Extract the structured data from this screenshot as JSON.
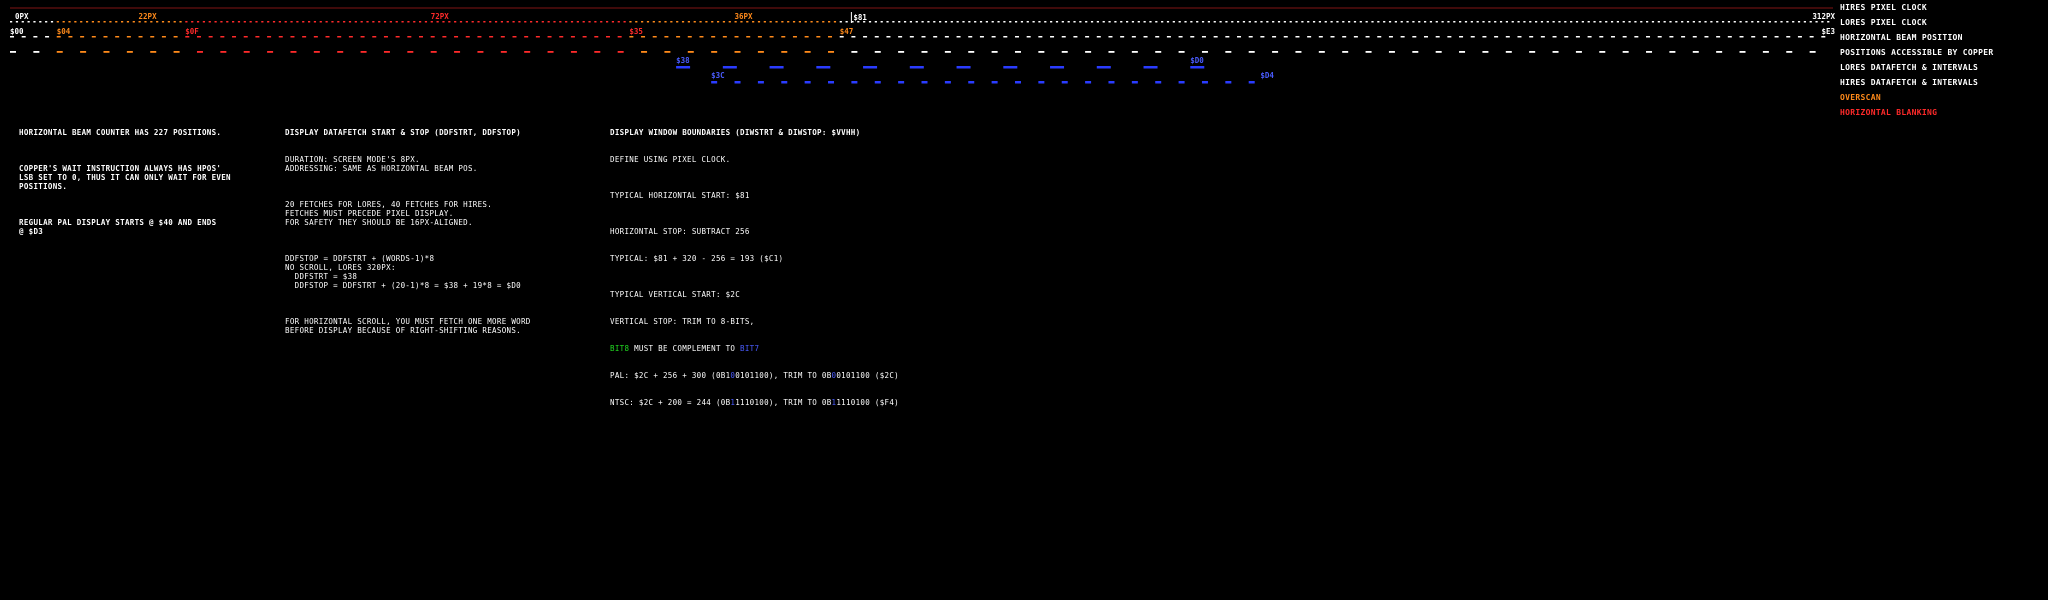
{
  "colors": {
    "white": "#ffffff",
    "orange": "#ff8a1a",
    "red": "#ff2a2a",
    "blue": "#2a3cff",
    "blue_text": "#4a5cff",
    "green": "#22dd22",
    "grey": "#888888",
    "background": "#000000"
  },
  "ruler": {
    "px_labels": [
      {
        "text": "0PX",
        "pos": 0,
        "color": "white"
      },
      {
        "text": "22PX",
        "pos": 22,
        "color": "orange"
      },
      {
        "text": "72PX",
        "pos": 72,
        "color": "red"
      },
      {
        "text": "36PX",
        "pos": 124,
        "color": "orange"
      },
      {
        "text": "312PX",
        "pos": 312,
        "color": "white"
      }
    ],
    "hex_labels": [
      {
        "text": "$00",
        "pos": 0,
        "color": "white"
      },
      {
        "text": "$04",
        "pos": 8,
        "color": "orange"
      },
      {
        "text": "$0F",
        "pos": 30,
        "color": "red"
      },
      {
        "text": "$35",
        "pos": 106,
        "color": "red"
      },
      {
        "text": "$47",
        "pos": 142,
        "color": "orange"
      },
      {
        "text": "$E3",
        "pos": 312,
        "color": "white"
      }
    ],
    "marker": {
      "text": "$81",
      "pos": 144,
      "color": "white"
    }
  },
  "datafetch": {
    "lores_start_label": "$38",
    "lores_end_label": "$D0",
    "hires_start_label": "$3C",
    "hires_end_label": "$D4",
    "lores_start": 114,
    "lores_end": 202,
    "lores_step": 8,
    "hires_start": 120,
    "hires_end": 214,
    "hires_step": 8
  },
  "legend": [
    {
      "label": "HIRES PIXEL CLOCK",
      "color": "white"
    },
    {
      "label": "LORES PIXEL CLOCK",
      "color": "white"
    },
    {
      "label": "HORIZONTAL BEAM POSITION",
      "color": "white"
    },
    {
      "label": "POSITIONS ACCESSIBLE BY COPPER",
      "color": "white"
    },
    {
      "label": "LORES DATAFETCH & INTERVALS",
      "color": "white"
    },
    {
      "label": "HIRES DATAFETCH & INTERVALS",
      "color": "white"
    },
    {
      "label": "OVERSCAN",
      "color": "orange"
    },
    {
      "label": "HORIZONTAL BLANKING",
      "color": "red"
    }
  ],
  "notes": {
    "col1": {
      "p1": "HORIZONTAL BEAM COUNTER HAS 227 POSITIONS.",
      "p2": "COPPER'S WAIT INSTRUCTION ALWAYS HAS HPOS'\nLSB SET TO 0, THUS IT CAN ONLY WAIT FOR EVEN\nPOSITIONS.",
      "p3": "REGULAR PAL DISPLAY STARTS @ $40 AND ENDS\n@ $D3"
    },
    "col2": {
      "title": "DISPLAY DATAFETCH START & STOP (DDFSTRT, DDFSTOP)",
      "p1": "DURATION: SCREEN MODE'S 8PX.\nADDRESSING: SAME AS HORIZONTAL BEAM POS.",
      "p2": "20 FETCHES FOR LORES, 40 FETCHES FOR HIRES.\nFETCHES MUST PRECEDE PIXEL DISPLAY.\nFOR SAFETY THEY SHOULD BE 16PX-ALIGNED.",
      "p3": "DDFSTOP = DDFSTRT + (WORDS-1)*8\nNO SCROLL, LORES 320PX:\n  DDFSTRT = $38\n  DDFSTOP = DDFSTRT + (20-1)*8 = $38 + 19*8 = $D0",
      "p4": "FOR HORIZONTAL SCROLL, YOU MUST FETCH ONE MORE WORD\nBEFORE DISPLAY BECAUSE OF RIGHT-SHIFTING REASONS."
    },
    "col3": {
      "title": "DISPLAY WINDOW BOUNDARIES (DIWSTRT & DIWSTOP: $VVHH)",
      "sub": "DEFINE USING PIXEL CLOCK.",
      "p1": "TYPICAL HORIZONTAL START: $81",
      "p2a": "HORIZONTAL STOP: SUBTRACT 256",
      "p2b": "TYPICAL: $81 + 320 - 256 = 193 ($C1)",
      "p3a": "TYPICAL VERTICAL START: $2C",
      "p3b": "VERTICAL STOP: TRIM TO 8-BITS,",
      "bits_word": "BIT8",
      "bits_mid": " MUST BE COMPLEMENT TO ",
      "bits_word2": "BIT7",
      "pal_a": "PAL: $2C + 256 + 300 (0B1",
      "pal_b": "0",
      "pal_c": "0101100), TRIM TO 0B",
      "pal_d": "0",
      "pal_e": "0101100 ($2C)",
      "ntsc_a": "NTSC: $2C + 200 = 244 (0B",
      "ntsc_b": "1",
      "ntsc_c": "1110100), TRIM TO 0B",
      "ntsc_d": "1",
      "ntsc_e": "1110100 ($F4)"
    }
  }
}
